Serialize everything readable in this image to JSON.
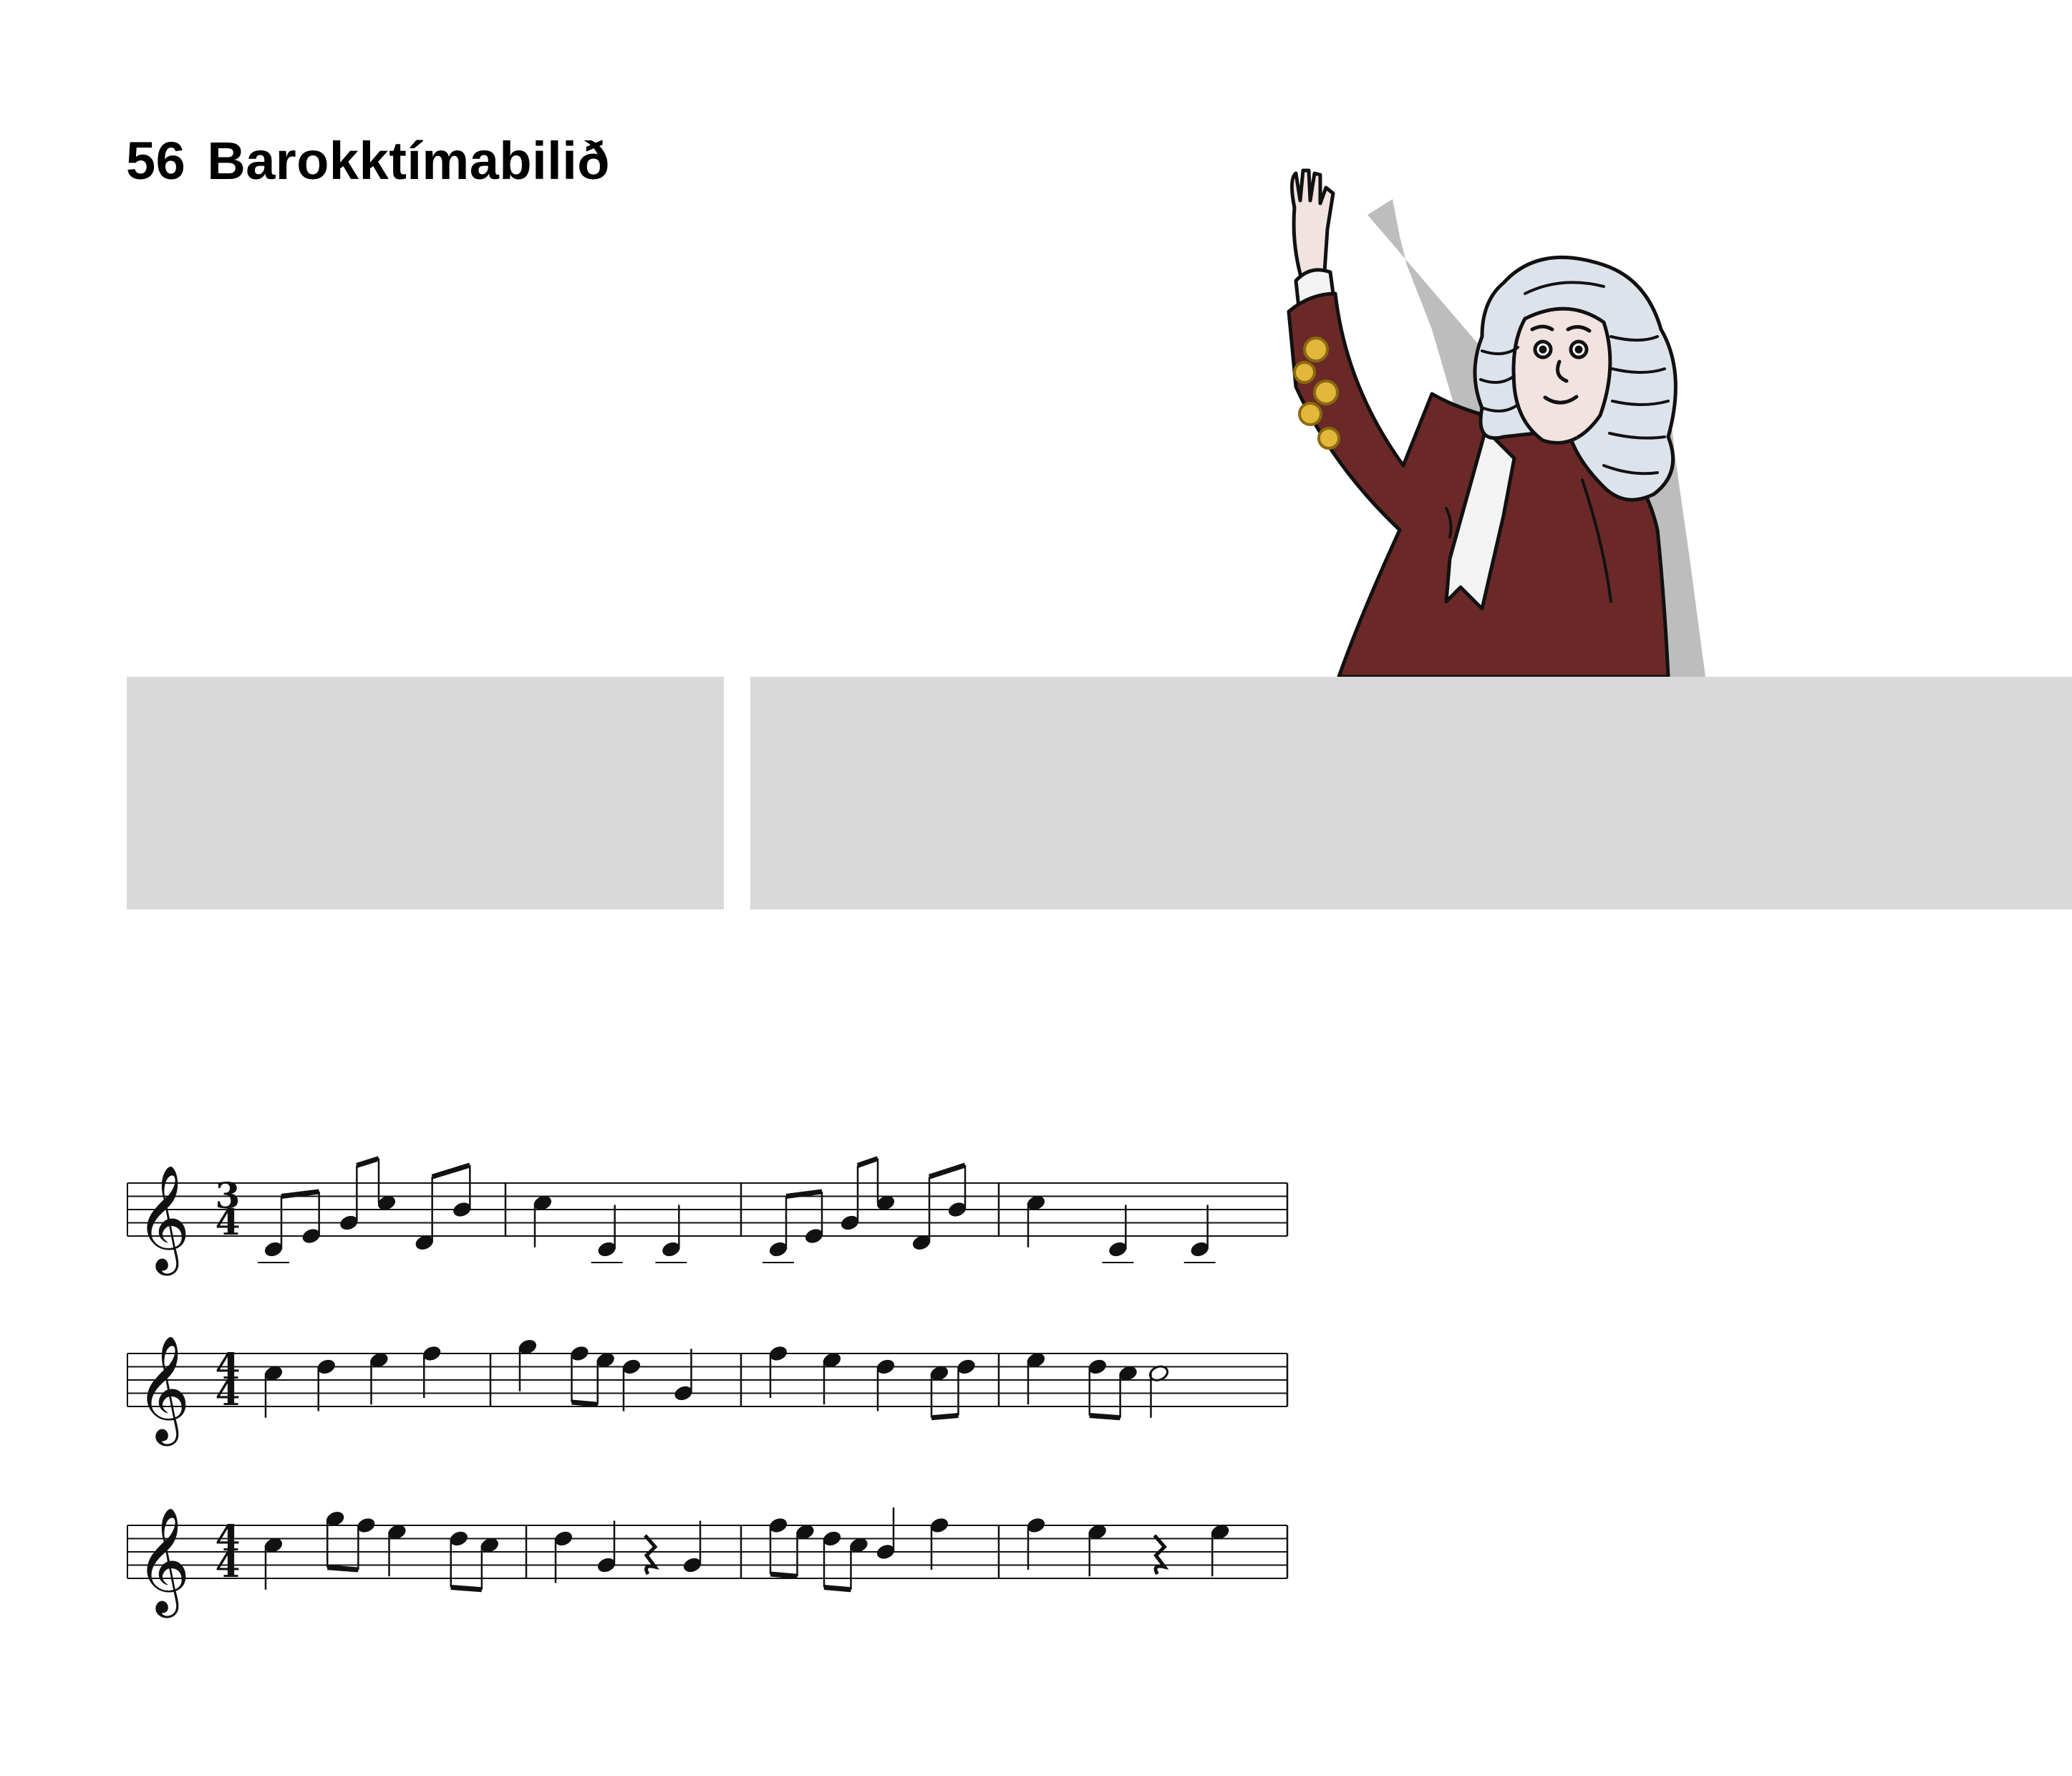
{
  "page": {
    "number": "56",
    "title": "Barokktímabilið"
  },
  "illustration": {
    "subject": "composer-in-wig-raising-hand",
    "colors": {
      "coat": "#6a2927",
      "wig": "#dde3ea",
      "skin": "#f1e3e0",
      "embroidery": "#e3b73a",
      "shadow": "#bdbdbd"
    }
  },
  "panels": {
    "color": "#d9d9d9"
  },
  "music": {
    "clef": "treble",
    "staves": [
      {
        "time_signature": [
          "3",
          "4"
        ],
        "measures": [
          [
            {
              "p": "C4",
              "d": "8",
              "beam": 1
            },
            {
              "p": "E4",
              "d": "8",
              "beam": 1
            },
            {
              "p": "G4",
              "d": "8",
              "beam": 2
            },
            {
              "p": "C5",
              "d": "8",
              "beam": 2
            },
            {
              "p": "D4",
              "d": "8",
              "beam": 3
            },
            {
              "p": "B4",
              "d": "8",
              "beam": 3
            }
          ],
          [
            {
              "p": "C5",
              "d": "4"
            },
            {
              "p": "C4",
              "d": "4"
            },
            {
              "p": "C4",
              "d": "4"
            }
          ],
          [
            {
              "p": "C4",
              "d": "8",
              "beam": 1
            },
            {
              "p": "E4",
              "d": "8",
              "beam": 1
            },
            {
              "p": "G4",
              "d": "8",
              "beam": 2
            },
            {
              "p": "C5",
              "d": "8",
              "beam": 2
            },
            {
              "p": "D4",
              "d": "8",
              "beam": 3
            },
            {
              "p": "B4",
              "d": "8",
              "beam": 3
            }
          ],
          [
            {
              "p": "C5",
              "d": "4"
            },
            {
              "p": "C4",
              "d": "4"
            },
            {
              "p": "C4",
              "d": "4"
            }
          ]
        ]
      },
      {
        "time_signature": [
          "4",
          "4"
        ],
        "measures": [
          [
            {
              "p": "C5",
              "d": "4"
            },
            {
              "p": "D5",
              "d": "4"
            },
            {
              "p": "E5",
              "d": "4"
            },
            {
              "p": "F5",
              "d": "4"
            }
          ],
          [
            {
              "p": "G5",
              "d": "4"
            },
            {
              "p": "F5",
              "d": "8",
              "beam": 1
            },
            {
              "p": "E5",
              "d": "8",
              "beam": 1
            },
            {
              "p": "D5",
              "d": "4"
            },
            {
              "p": "G4",
              "d": "4"
            }
          ],
          [
            {
              "p": "F5",
              "d": "4"
            },
            {
              "p": "E5",
              "d": "4"
            },
            {
              "p": "D5",
              "d": "4"
            },
            {
              "p": "C5",
              "d": "8",
              "beam": 1
            },
            {
              "p": "D5",
              "d": "8",
              "beam": 1
            }
          ],
          [
            {
              "p": "E5",
              "d": "4"
            },
            {
              "p": "D5",
              "d": "8",
              "beam": 1
            },
            {
              "p": "C5",
              "d": "8",
              "beam": 1
            },
            {
              "p": "C5",
              "d": "2"
            }
          ]
        ]
      },
      {
        "time_signature": [
          "4",
          "4"
        ],
        "measures": [
          [
            {
              "p": "C5",
              "d": "4"
            },
            {
              "p": "G5",
              "d": "8",
              "beam": 1
            },
            {
              "p": "F5",
              "d": "8",
              "beam": 1
            },
            {
              "p": "E5",
              "d": "4"
            },
            {
              "p": "D5",
              "d": "8",
              "beam": 2
            },
            {
              "p": "C5",
              "d": "8",
              "beam": 2
            }
          ],
          [
            {
              "p": "D5",
              "d": "4"
            },
            {
              "p": "G4",
              "d": "4"
            },
            {
              "rest": "4"
            },
            {
              "p": "G4",
              "d": "4"
            }
          ],
          [
            {
              "p": "F5",
              "d": "8",
              "beam": 1
            },
            {
              "p": "E5",
              "d": "8",
              "beam": 1
            },
            {
              "p": "D5",
              "d": "8",
              "beam": 2
            },
            {
              "p": "C5",
              "d": "8",
              "beam": 2
            },
            {
              "p": "B4",
              "d": "4"
            },
            {
              "p": "F5",
              "d": "4"
            }
          ],
          [
            {
              "p": "F5",
              "d": "4"
            },
            {
              "p": "E5",
              "d": "4"
            },
            {
              "rest": "4"
            },
            {
              "p": "E5",
              "d": "4"
            }
          ]
        ]
      }
    ]
  }
}
